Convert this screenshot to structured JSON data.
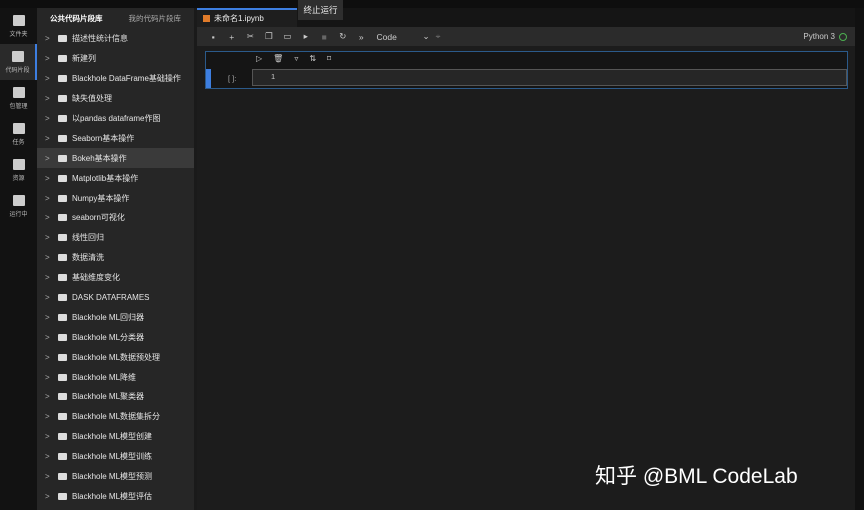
{
  "iconbar": [
    {
      "label": "文件夹"
    },
    {
      "label": "代码片段"
    },
    {
      "label": "包管理"
    },
    {
      "label": "任务"
    },
    {
      "label": "资源"
    },
    {
      "label": "运行中"
    }
  ],
  "sidebar": {
    "tabs": [
      "公共代码片段库",
      "我的代码片段库"
    ],
    "items": [
      "描述性统计信息",
      "新建列",
      "Blackhole DataFrame基础操作",
      "缺失值处理",
      "以pandas dataframe作图",
      "Seaborn基本操作",
      "Bokeh基本操作",
      "Matplotlib基本操作",
      "Numpy基本操作",
      "seaborn可视化",
      "线性回归",
      "数据清洗",
      "基础维度变化",
      "DASK DATAFRAMES",
      "Blackhole ML回归器",
      "Blackhole ML分类器",
      "Blackhole ML数据预处理",
      "Blackhole ML降维",
      "Blackhole ML聚类器",
      "Blackhole ML数据集拆分",
      "Blackhole ML模型创建",
      "Blackhole ML模型训练",
      "Blackhole ML模型预测",
      "Blackhole ML模型评估"
    ],
    "selected": 6
  },
  "tab": {
    "title": "未命名1.ipynb"
  },
  "tooltip": "终止运行",
  "toolbar": {
    "cell_type": "Code",
    "kernel": "Python 3"
  },
  "cell": {
    "prompt": "[ ]:",
    "line": "1"
  },
  "watermark": "知乎 @BML CodeLab"
}
